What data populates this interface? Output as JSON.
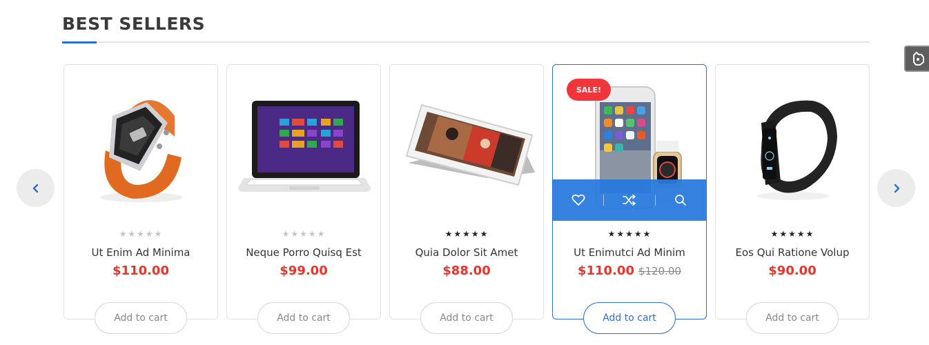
{
  "section": {
    "title": "BEST SELLERS"
  },
  "colors": {
    "accent": "#2f6ed1",
    "price": "#e8342a",
    "sale": "#f0363b",
    "star_filled": "#222222",
    "star_empty": "#c4c4c4"
  },
  "icons": {
    "prev": "chevron-left-icon",
    "next": "chevron-right-icon",
    "wishlist": "heart-icon",
    "compare": "shuffle-icon",
    "quickview": "search-icon",
    "corner": "hand-pointer-icon"
  },
  "products": [
    {
      "name": "Ut Enim Ad Minima",
      "price": "$110.00",
      "old_price": "",
      "rating": 0,
      "rating_max": 5,
      "sale": "",
      "image": "orange-wristwatch",
      "cart_label": "Add to cart"
    },
    {
      "name": "Neque Porro Quisq Est",
      "price": "$99.00",
      "old_price": "",
      "rating": 0,
      "rating_max": 5,
      "sale": "",
      "image": "laptop",
      "cart_label": "Add to cart"
    },
    {
      "name": "Quia Dolor Sit Amet",
      "price": "$88.00",
      "old_price": "",
      "rating": 5,
      "rating_max": 5,
      "sale": "",
      "image": "tablet-with-stand",
      "cart_label": "Add to cart"
    },
    {
      "name": "Ut Enimutci Ad Minim",
      "price": "$110.00",
      "old_price": "$120.00",
      "rating": 5,
      "rating_max": 5,
      "sale": "SALE!",
      "image": "smartphone-and-smartwatch",
      "cart_label": "Add to cart"
    },
    {
      "name": "Eos Qui Ratione Volup",
      "price": "$90.00",
      "old_price": "",
      "rating": 5,
      "rating_max": 5,
      "sale": "",
      "image": "fitness-band",
      "cart_label": "Add to cart"
    }
  ]
}
